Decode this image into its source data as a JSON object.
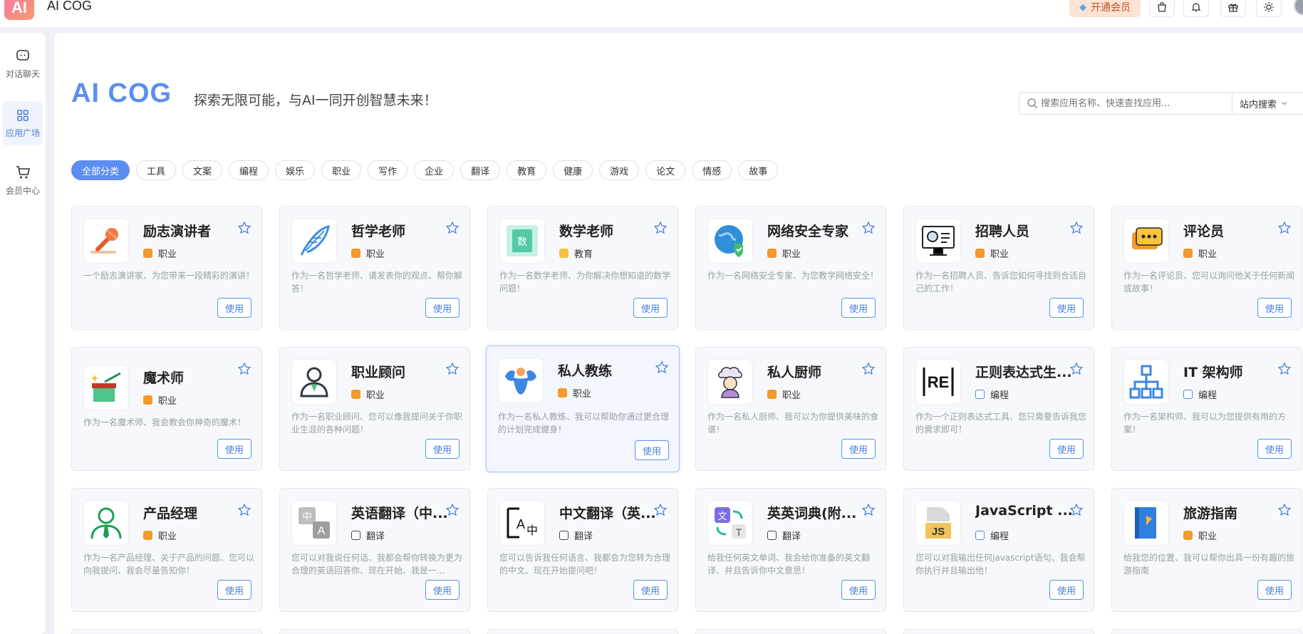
{
  "header": {
    "logo_text": "AI",
    "app_title": "AI COG",
    "vip_label": "开通会员",
    "icons": [
      "bag-icon",
      "bell-icon",
      "gift-icon",
      "sun-icon"
    ]
  },
  "sidebar": {
    "items": [
      {
        "label": "对话聊天",
        "icon": "chat-icon",
        "active": false
      },
      {
        "label": "应用广场",
        "icon": "grid-icon",
        "active": true
      },
      {
        "label": "会员中心",
        "icon": "cart-icon",
        "active": false
      }
    ]
  },
  "main": {
    "brand": "AI COG",
    "slogan": "探索无限可能，与AI一同开创智慧未来！",
    "search_placeholder": "搜索应用名称、快速查找应用...",
    "search_scope": "站内搜索",
    "categories": [
      "全部分类",
      "工具",
      "文案",
      "编程",
      "娱乐",
      "职业",
      "写作",
      "企业",
      "翻译",
      "教育",
      "健康",
      "游戏",
      "论文",
      "情感",
      "故事"
    ],
    "use_label": "使用",
    "cards": [
      {
        "title": "励志演讲者",
        "tag": "职业",
        "desc": "一个励志演讲家、为您带来一段精彩的演讲！",
        "icon": "microphone-icon"
      },
      {
        "title": "哲学老师",
        "tag": "职业",
        "desc": "作为一名哲学老师、请发表你的观点、帮你解答！",
        "icon": "feather-icon"
      },
      {
        "title": "数学老师",
        "tag": "教育",
        "desc": "作为一名数学老师、为你解决你想知道的数学问题！",
        "icon": "math-book-icon"
      },
      {
        "title": "网络安全专家",
        "tag": "职业",
        "desc": "作为一名网络安全专家、为您教学网络安全！",
        "icon": "globe-shield-icon"
      },
      {
        "title": "招聘人员",
        "tag": "职业",
        "desc": "作为一名招聘人员、告诉您如何寻找到合适自己的工作！",
        "icon": "recruiter-icon"
      },
      {
        "title": "评论员",
        "tag": "职业",
        "desc": "作为一名评论员、您可以询问他关于任何新闻或故事！",
        "icon": "chat-bubble-icon"
      },
      {
        "title": "魔术师",
        "tag": "职业",
        "desc": "作为一名魔术师、我会教会你神奇的魔术！",
        "icon": "magic-hat-icon"
      },
      {
        "title": "职业顾问",
        "tag": "职业",
        "desc": "作为一名职业顾问、您可以像我提问关于你职业生涯的各种问题！",
        "icon": "consultant-icon"
      },
      {
        "title": "私人教练",
        "tag": "职业",
        "desc": "作为一名私人教练、我可以帮助你通过更合理的计划完成健身！",
        "icon": "muscle-icon"
      },
      {
        "title": "私人厨师",
        "tag": "职业",
        "desc": "作为一名私人厨师、我可以为你提供美味的食谱！",
        "icon": "chef-icon"
      },
      {
        "title": "正则表达式生...",
        "tag": "编程",
        "desc": "作为一个正则表达式工具、您只需要告诉我您的需求即可！",
        "icon": "regex-icon"
      },
      {
        "title": "IT 架构师",
        "tag": "编程",
        "desc": "作为一名架构师、我可以为您提供有用的方案！",
        "icon": "hierarchy-icon"
      },
      {
        "title": "产品经理",
        "tag": "职业",
        "desc": "作为一名产品经理、关于产品的问题、您可以向我提问、我会尽量告知你！",
        "icon": "manager-icon"
      },
      {
        "title": "英语翻译（中...",
        "tag": "翻译",
        "desc": "您可以对我说任何话、我都会帮你转换为更为合理的英语回答你、现在开始、我是一...",
        "icon": "translate-zh-en-icon"
      },
      {
        "title": "中文翻译（英...",
        "tag": "翻译",
        "desc": "您可以告诉我任何语言、我都会为您转为合理的中文、现在开始提问吧！",
        "icon": "translate-en-zh-icon"
      },
      {
        "title": "英英词典(附...",
        "tag": "翻译",
        "desc": "给我任何英文单词、我会给你准备的英文翻译、并且告诉你中文意思！",
        "icon": "dictionary-icon"
      },
      {
        "title": "JavaScript ...",
        "tag": "编程",
        "desc": "您可以对我输出任何javascript语句、我会帮你执行并且输出他！",
        "icon": "js-file-icon"
      },
      {
        "title": "旅游指南",
        "tag": "职业",
        "desc": "给我您的位置、我可以帮你出具一份有趣的旅游指南",
        "icon": "guide-book-icon"
      }
    ]
  }
}
